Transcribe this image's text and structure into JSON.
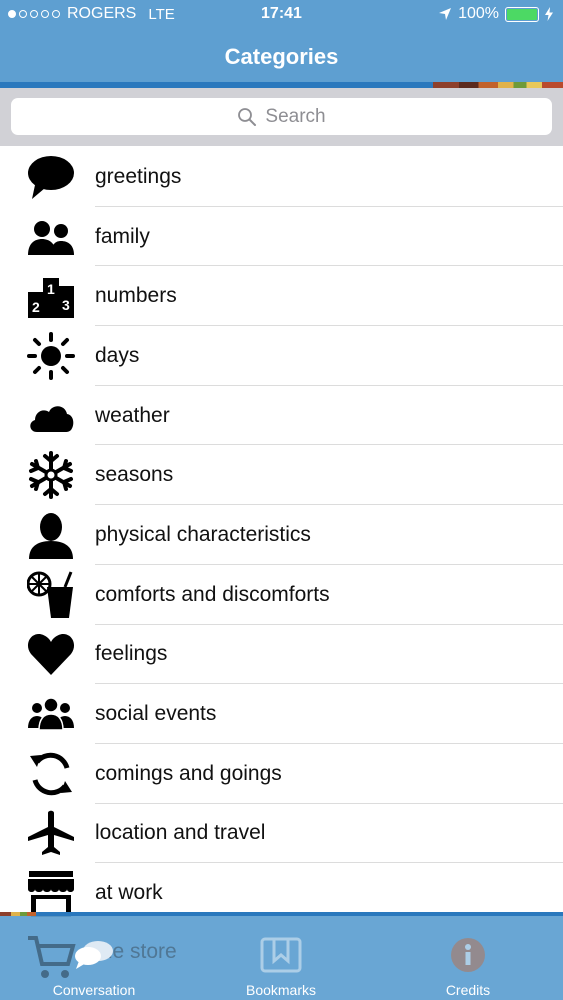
{
  "status_bar": {
    "carrier": "ROGERS",
    "network": "LTE",
    "time": "17:41",
    "battery": "100%",
    "signal_bars_filled": 1,
    "signal_bars_total": 5
  },
  "header": {
    "title": "Categories"
  },
  "search": {
    "placeholder": "Search"
  },
  "categories": [
    {
      "label": "greetings",
      "icon": "speech-bubble-icon"
    },
    {
      "label": "family",
      "icon": "people-pair-icon"
    },
    {
      "label": "numbers",
      "icon": "numbers-icon"
    },
    {
      "label": "days",
      "icon": "sun-icon"
    },
    {
      "label": "weather",
      "icon": "cloud-icon"
    },
    {
      "label": "seasons",
      "icon": "snowflake-icon"
    },
    {
      "label": "physical characteristics",
      "icon": "person-silhouette-icon"
    },
    {
      "label": "comforts and discomforts",
      "icon": "drink-icon"
    },
    {
      "label": "feelings",
      "icon": "heart-icon"
    },
    {
      "label": "social events",
      "icon": "group-icon"
    },
    {
      "label": "comings and goings",
      "icon": "cycle-arrows-icon"
    },
    {
      "label": "location and travel",
      "icon": "airplane-icon"
    },
    {
      "label": "at work",
      "icon": "storefront-icon"
    }
  ],
  "partially_hidden_row": {
    "label": "the store",
    "icon": "shopping-cart-icon"
  },
  "tabs": [
    {
      "label": "Conversation",
      "icon": "chat-bubbles-icon",
      "selected": true
    },
    {
      "label": "Bookmarks",
      "icon": "bookmark-icon",
      "selected": false
    },
    {
      "label": "Credits",
      "icon": "info-icon",
      "selected": false
    }
  ],
  "colors": {
    "header_blue": "#5e9fd1",
    "accent_blue": "#2a78bd",
    "battery_green": "#4cd964"
  }
}
